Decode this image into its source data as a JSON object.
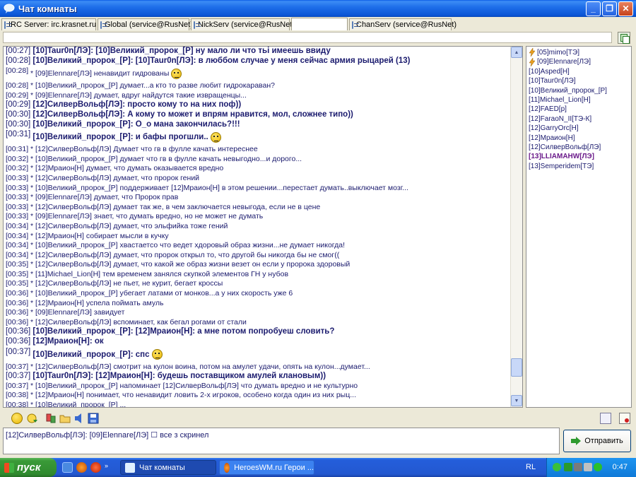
{
  "window": {
    "title": "Чат комнаты"
  },
  "tabs": [
    {
      "label": "IRC Server: irc.krasnet.ru",
      "active": false
    },
    {
      "label": "Global (service@RusNet)",
      "active": false
    },
    {
      "label": "NickServ (service@RusNet)",
      "active": false
    },
    {
      "label": "",
      "active": true
    },
    {
      "label": "ChanServ (service@RusNet)",
      "active": false
    }
  ],
  "chat": {
    "lines": [
      {
        "ts": "[00:27]",
        "text": "[10]Taur0n[ЛЭ]: [10]Великий_пророк_[Р] ну мало ли что тьi имеешь ввиду",
        "big": true
      },
      {
        "ts": "[00:28]",
        "text": "[10]Великий_пророк_[Р]: [10]Taur0n[ЛЭ]: в люббом случае у меня сейчас армия рыцарей (13)",
        "big": true
      },
      {
        "ts": "[00:28]",
        "text": "* [09]Elennare[ЛЭ] ненавидит гидрованы",
        "smiley": true,
        "tall": true
      },
      {
        "ts": "[00:28]",
        "text": "* [10]Великий_пророк_[Р] думает...а кто то разве любит гидрокараван?"
      },
      {
        "ts": "[00:29]",
        "text": "* [09]Elennare[ЛЭ] думает, вдруг найдутся такие извращенцы..."
      },
      {
        "ts": "[00:29]",
        "text": "[12]СилверВольф[ЛЭ]: просто кому то на них поф))",
        "big": true
      },
      {
        "ts": "[00:30]",
        "text": "[12]СилверВольф[ЛЭ]: А кому то может и впрям нравится, мол, сложнее типо))",
        "big": true
      },
      {
        "ts": "[00:30]",
        "text": "[10]Великий_пророк_[Р]: О_о мана закончилась?!!!",
        "big": true
      },
      {
        "ts": "[00:31]",
        "text": "[10]Великий_пророк_[Р]: и бафы прогшли..",
        "big": true,
        "smiley": true,
        "tall": true
      },
      {
        "ts": "[00:31]",
        "text": "* [12]СилверВольф[ЛЭ] Думает что гв в фулле качать интереснее"
      },
      {
        "ts": "[00:32]",
        "text": "* [10]Великий_пророк_[Р] думает что гв в фулле качать невыгодно...и дорого..."
      },
      {
        "ts": "[00:32]",
        "text": "* [12]Мраион[Н] думает, что думать оказывается вредно"
      },
      {
        "ts": "[00:33]",
        "text": "* [12]СилверВольф[ЛЭ] думает, что пророк гений"
      },
      {
        "ts": "[00:33]",
        "text": "* [10]Великий_пророк_[Р] поддерживает [12]Мраион[Н]  в этом решении...перестает думать..выключает мозг..."
      },
      {
        "ts": "[00:33]",
        "text": "* [09]Elennare[ЛЭ] думает, что Пророк прав"
      },
      {
        "ts": "[00:33]",
        "text": "* [12]СилверВольф[ЛЭ] думает так же, в чем заключается невыгода, если не в цене"
      },
      {
        "ts": "[00:33]",
        "text": "* [09]Elennare[ЛЭ] знает, что думать вредно, но не может не думать"
      },
      {
        "ts": "[00:34]",
        "text": "* [12]СилверВольф[ЛЭ] думает, что эльфийка тоже гений"
      },
      {
        "ts": "[00:34]",
        "text": "* [12]Мраион[Н] собирает мысли в кучку"
      },
      {
        "ts": "[00:34]",
        "text": "* [10]Великий_пророк_[Р] хвастаетсо что ведет хдоровый образ жизни...не думает никогда!"
      },
      {
        "ts": "[00:34]",
        "text": "* [12]СилверВольф[ЛЭ] думает, что пророк открыл то, что другой бы никогда бы не смог(("
      },
      {
        "ts": "[00:35]",
        "text": "* [12]СилверВольф[ЛЭ] думает, что какой же образ жизни везет он если у пророка здоровый"
      },
      {
        "ts": "[00:35]",
        "text": "* [11]Michael_Lion[Н] тем временем занялся скупкой элементов ГН у нубов"
      },
      {
        "ts": "[00:35]",
        "text": "* [12]СилверВольф[ЛЭ] не пьет, не курит, бегает кроссы"
      },
      {
        "ts": "[00:36]",
        "text": "* [10]Великий_пророк_[Р] убегает латами от монков...а у них скорость уже 6"
      },
      {
        "ts": "[00:36]",
        "text": "* [12]Мраион[Н] успела поймать амуль"
      },
      {
        "ts": "[00:36]",
        "text": "* [09]Elennare[ЛЭ] завидует"
      },
      {
        "ts": "[00:36]",
        "text": "* [12]СилверВольф[ЛЭ] вспоминает, как бегал рогами от стали"
      },
      {
        "ts": "[00:36]",
        "text": "[10]Великий_пророк_[Р]: [12]Мраион[Н]: а мне потом попробуеш словить?",
        "big": true
      },
      {
        "ts": "[00:36]",
        "text": "[12]Мраион[Н]: ок",
        "big": true
      },
      {
        "ts": "[00:37]",
        "text": "[10]Великий_пророк_[Р]: спс",
        "big": true,
        "smiley": true,
        "tall": true
      },
      {
        "ts": "[00:37]",
        "text": "* [12]СилверВольф[ЛЭ] смотрит на кулон воина, потом на амулет удачи, опять на кулон...думает..."
      },
      {
        "ts": "[00:37]",
        "text": "[10]Taur0n[ЛЭ]: [12]Мраион[Н]: будешь поставщиком амулей клановым))",
        "big": true
      },
      {
        "ts": "[00:37]",
        "text": "* [10]Великий_пророк_[Р] напоминает [12]СилверВольф[ЛЭ]  что думать вредно и не культурно"
      },
      {
        "ts": "[00:38]",
        "text": "* [12]Мраион[Н] понимает, что ненавидит ловить 2-х игроков, особено когда один из них рыц..."
      },
      {
        "ts": "[00:38]",
        "text": "* [10]Великий_пророк_[Р] ..."
      }
    ]
  },
  "nicklist": [
    {
      "nick": "[05]mimo[ТЭ]",
      "op": true
    },
    {
      "nick": "[09]Elennare[ЛЭ]",
      "op": true
    },
    {
      "nick": "[10]Asped[Н]"
    },
    {
      "nick": "[10]Taur0n[ЛЭ]"
    },
    {
      "nick": "[10]Великий_пророк_[Р]"
    },
    {
      "nick": "[11]Michael_Lion[Н]"
    },
    {
      "nick": "[12]FAED[р]"
    },
    {
      "nick": "[12]FaraoN_II[ТЭ-К]"
    },
    {
      "nick": "[12]GarryOrc[Н]"
    },
    {
      "nick": "[12]Мраион[Н]"
    },
    {
      "nick": "[12]СилверВольф[ЛЭ]"
    },
    {
      "nick": "[13]LLIAMAHW[ЛЭ]",
      "highlight": true
    },
    {
      "nick": "[13]Semperidem[ТЭ]"
    }
  ],
  "input": {
    "value": "[12]СилверВольф[ЛЭ]: [09]Elennare[ЛЭ]  ☐ все з скринел"
  },
  "send_button": {
    "label": "Отправить"
  },
  "taskbar": {
    "start_label": "пуск",
    "tasks": [
      {
        "label": "Чат комнаты",
        "active": true
      },
      {
        "label": "HeroesWM.ru Герои ...",
        "active": false
      }
    ],
    "language": "RL",
    "clock": "0:47"
  },
  "colors": {
    "titlebar": "#0b55d6",
    "chat_text": "#1b1b6e",
    "highlight_nick": "#6a1a8a",
    "taskbar": "#245edb",
    "start_button": "#3a9a38"
  }
}
